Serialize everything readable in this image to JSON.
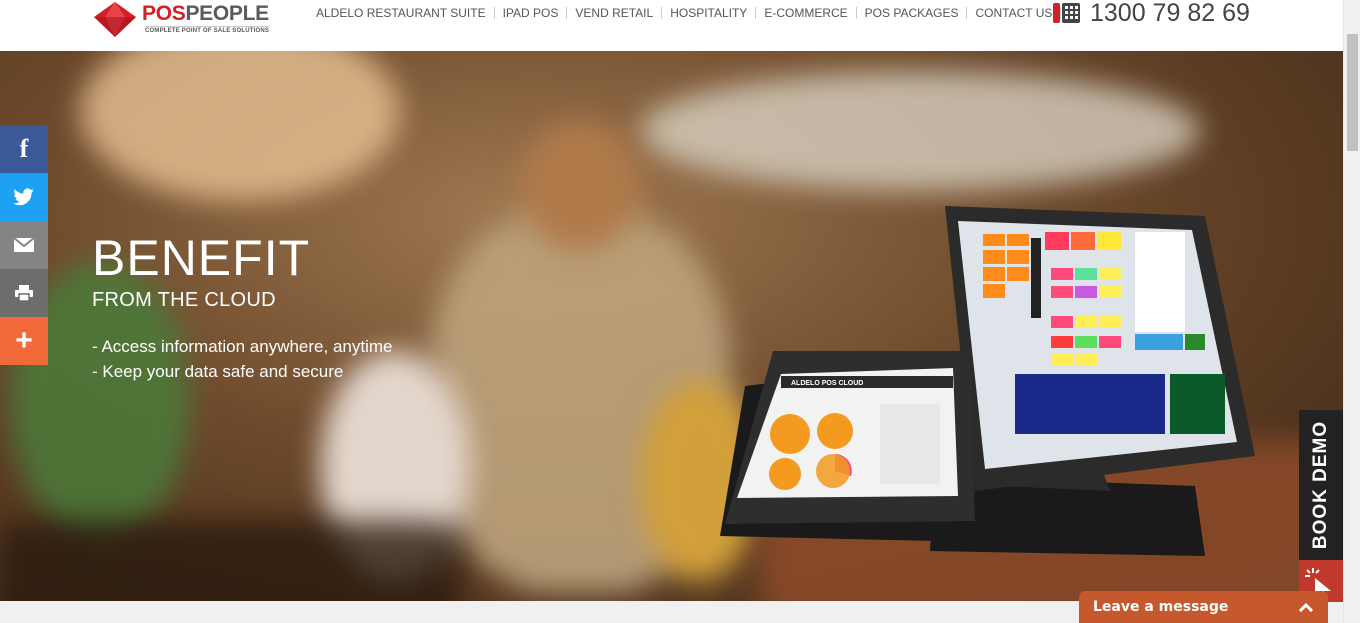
{
  "header": {
    "logo": {
      "name_part1": "POS",
      "name_part2": "PEOPLE",
      "tagline": "COMPLETE POINT OF SALE SOLUTIONS"
    },
    "nav": [
      {
        "label": "ALDELO RESTAURANT SUITE"
      },
      {
        "label": "IPAD POS"
      },
      {
        "label": "VEND RETAIL"
      },
      {
        "label": "HOSPITALITY"
      },
      {
        "label": "E-COMMERCE"
      },
      {
        "label": "POS PACKAGES"
      },
      {
        "label": "CONTACT US"
      }
    ],
    "phone": "1300 79 82 69"
  },
  "hero": {
    "title": "BENEFIT",
    "subtitle": "FROM THE CLOUD",
    "points": [
      "- Access information anywhere, anytime",
      "- Keep your data safe and secure"
    ]
  },
  "share": [
    {
      "name": "facebook",
      "color": "#3b5998",
      "glyph": "f"
    },
    {
      "name": "twitter",
      "color": "#1da1f2"
    },
    {
      "name": "email",
      "color": "#848484"
    },
    {
      "name": "print",
      "color": "#6d6d6d"
    },
    {
      "name": "more",
      "color": "#f26a3a",
      "glyph": "+"
    }
  ],
  "book_demo": {
    "label": "BOOK DEMO"
  },
  "chat": {
    "label": "Leave a message"
  },
  "tablet_screen_title": "ALDELO POS CLOUD"
}
